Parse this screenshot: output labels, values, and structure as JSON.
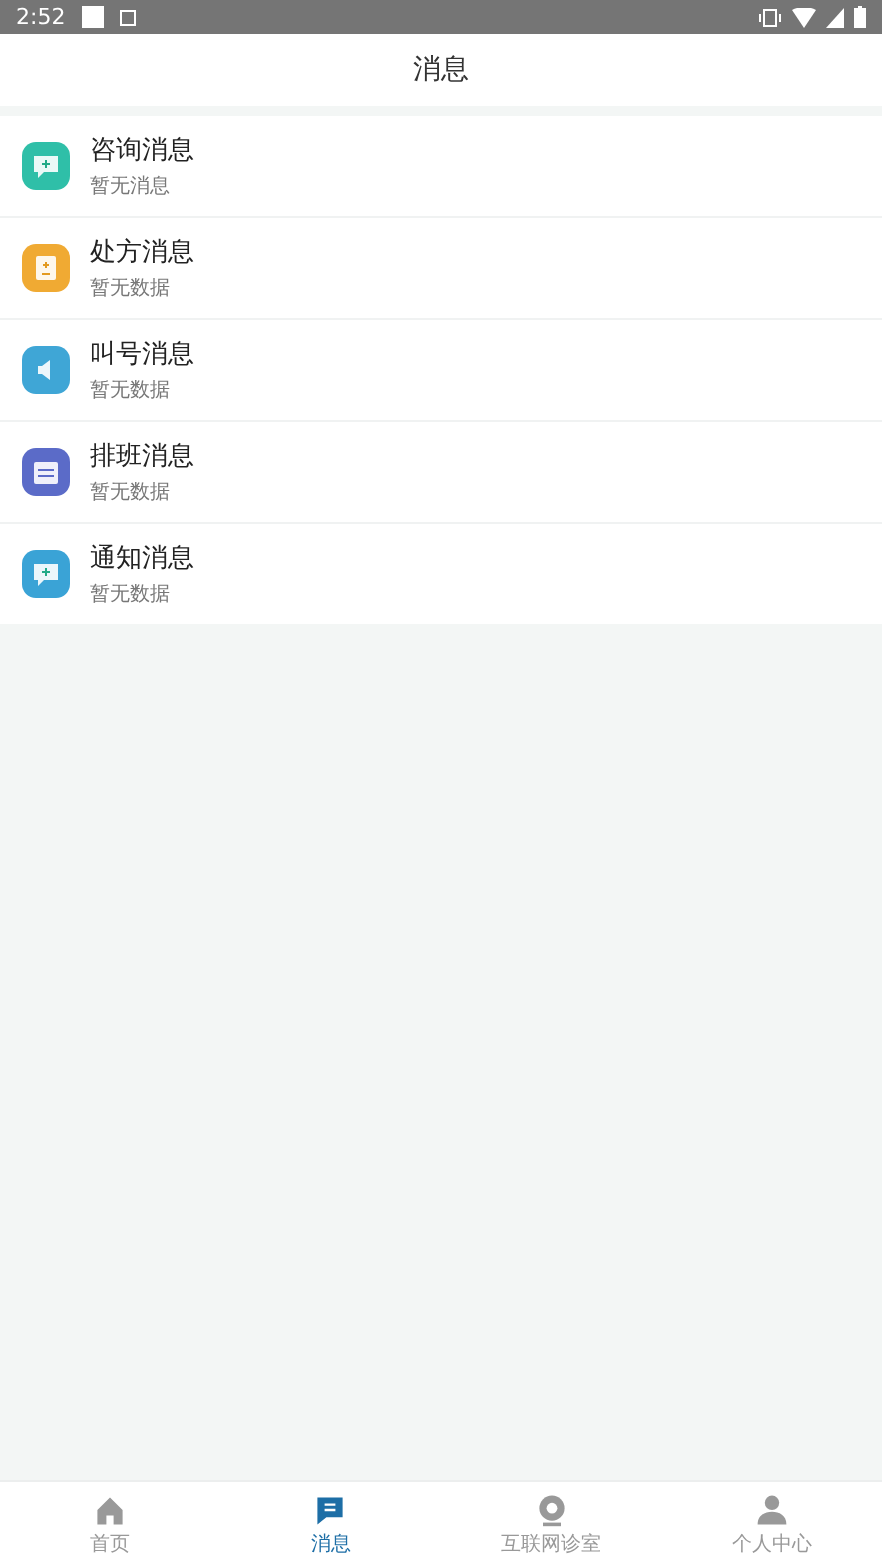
{
  "status_bar": {
    "time": "2:52"
  },
  "header": {
    "title": "消息"
  },
  "messages": [
    {
      "title": "咨询消息",
      "subtitle": "暂无消息",
      "kind": "chat",
      "color": "#2fbfa8"
    },
    {
      "title": "处方消息",
      "subtitle": "暂无数据",
      "kind": "prescription",
      "color": "#f0aa33"
    },
    {
      "title": "叫号消息",
      "subtitle": "暂无数据",
      "kind": "speaker",
      "color": "#3fa6d6"
    },
    {
      "title": "排班消息",
      "subtitle": "暂无数据",
      "kind": "calendar",
      "color": "#5b6bc8"
    },
    {
      "title": "通知消息",
      "subtitle": "暂无数据",
      "kind": "chat",
      "color": "#3aa3d6"
    }
  ],
  "tabs": [
    {
      "label": "首页",
      "kind": "home",
      "selected": false
    },
    {
      "label": "消息",
      "kind": "message",
      "selected": true
    },
    {
      "label": "互联网诊室",
      "kind": "camera",
      "selected": false
    },
    {
      "label": "个人中心",
      "kind": "person",
      "selected": false
    }
  ]
}
